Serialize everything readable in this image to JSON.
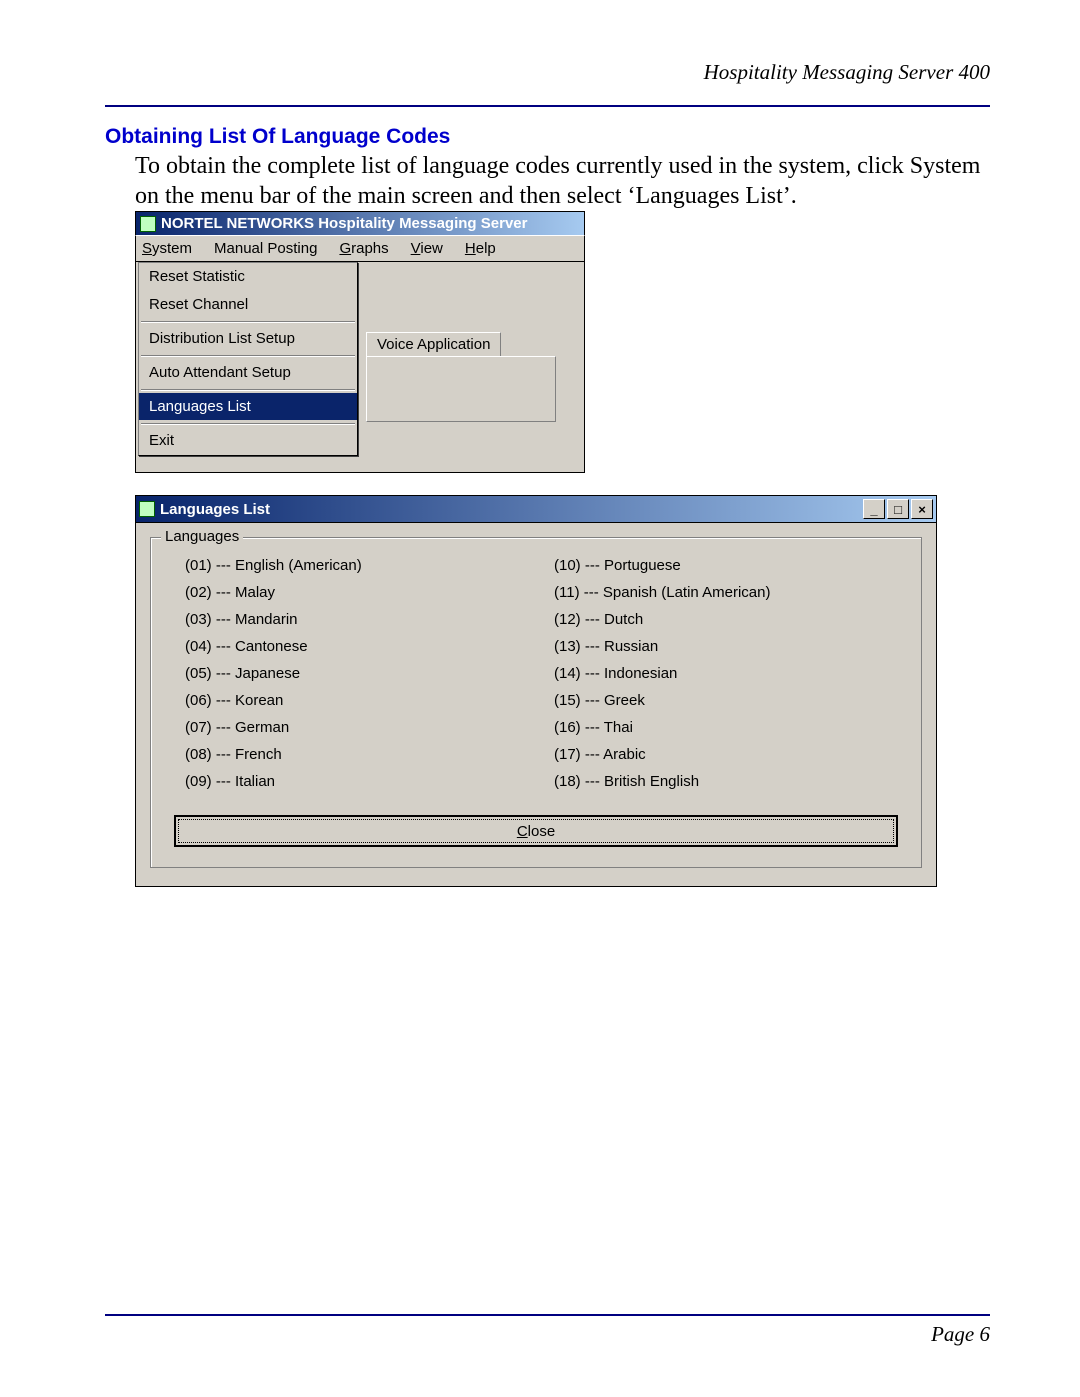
{
  "header": {
    "product": "Hospitality Messaging Server 400"
  },
  "section": {
    "title": "Obtaining List Of Language Codes"
  },
  "body": {
    "text": "To obtain the complete list of language codes currently used in the system, click System on the menu bar of the main screen and then select ‘Languages List’."
  },
  "shot1": {
    "title": "NORTEL NETWORKS Hospitality Messaging Server",
    "menu": {
      "system": "System",
      "manual_posting": "Manual Posting",
      "graphs": "Graphs",
      "view": "View",
      "help": "Help"
    },
    "dropdown": {
      "reset_statistic": "Reset Statistic",
      "reset_channel": "Reset Channel",
      "distribution_list_setup": "Distribution List Setup",
      "auto_attendant_setup": "Auto Attendant Setup",
      "languages_list": "Languages List",
      "exit": "Exit"
    },
    "tab": "Voice Application"
  },
  "shot2": {
    "title": "Languages List",
    "group": "Languages",
    "col1": [
      "(01) --- English (American)",
      "(02) --- Malay",
      "(03) --- Mandarin",
      "(04) --- Cantonese",
      "(05) --- Japanese",
      "(06) --- Korean",
      "(07) --- German",
      "(08) --- French",
      "(09) --- Italian"
    ],
    "col2": [
      "(10) --- Portuguese",
      "(11) --- Spanish (Latin American)",
      "(12) --- Dutch",
      "(13) --- Russian",
      "(14) --- Indonesian",
      "(15) --- Greek",
      "(16) --- Thai",
      "(17) --- Arabic",
      "(18) --- British English"
    ],
    "close": "Close",
    "btn_min": "_",
    "btn_max": "□",
    "btn_close": "×"
  },
  "footer": {
    "page": "Page 6"
  }
}
